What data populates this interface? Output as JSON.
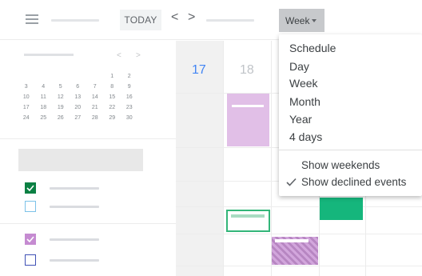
{
  "toolbar": {
    "menu_icon": "hamburger-menu-icon",
    "today_label": "TODAY",
    "prev_glyph": "<",
    "next_glyph": ">",
    "view_label": "Week"
  },
  "mini_calendar": {
    "weeks": [
      [
        "",
        "",
        "",
        "",
        "",
        "1",
        "2"
      ],
      [
        "3",
        "4",
        "5",
        "6",
        "7",
        "8",
        "9"
      ],
      [
        "10",
        "11",
        "12",
        "13",
        "14",
        "15",
        "16"
      ],
      [
        "17",
        "18",
        "19",
        "20",
        "21",
        "22",
        "23"
      ],
      [
        "24",
        "25",
        "26",
        "27",
        "28",
        "29",
        "30"
      ]
    ],
    "prev_glyph": "<",
    "next_glyph": ">"
  },
  "calendars": [
    {
      "checked": true,
      "color": "#0b8043"
    },
    {
      "checked": false,
      "color": "#7cc2e8"
    },
    {
      "checked": true,
      "color": "#c58bd1"
    },
    {
      "checked": false,
      "color": "#3f51b5"
    }
  ],
  "grid": {
    "days": [
      {
        "num": "17",
        "color": "#4285f4"
      },
      {
        "num": "18",
        "color": "#c0c4c8"
      }
    ]
  },
  "view_menu": {
    "items": [
      "Schedule",
      "Day",
      "Week",
      "Month",
      "Year",
      "4 days"
    ],
    "options": [
      {
        "label": "Show weekends",
        "checked": false
      },
      {
        "label": "Show declined events",
        "checked": true
      }
    ]
  },
  "colors": {
    "accent_blue": "#4285f4",
    "event_lilac": "#e1bfe7",
    "event_green": "#15b67c",
    "event_green_outline": "#33b679",
    "event_hatched": "#c58bd1"
  }
}
